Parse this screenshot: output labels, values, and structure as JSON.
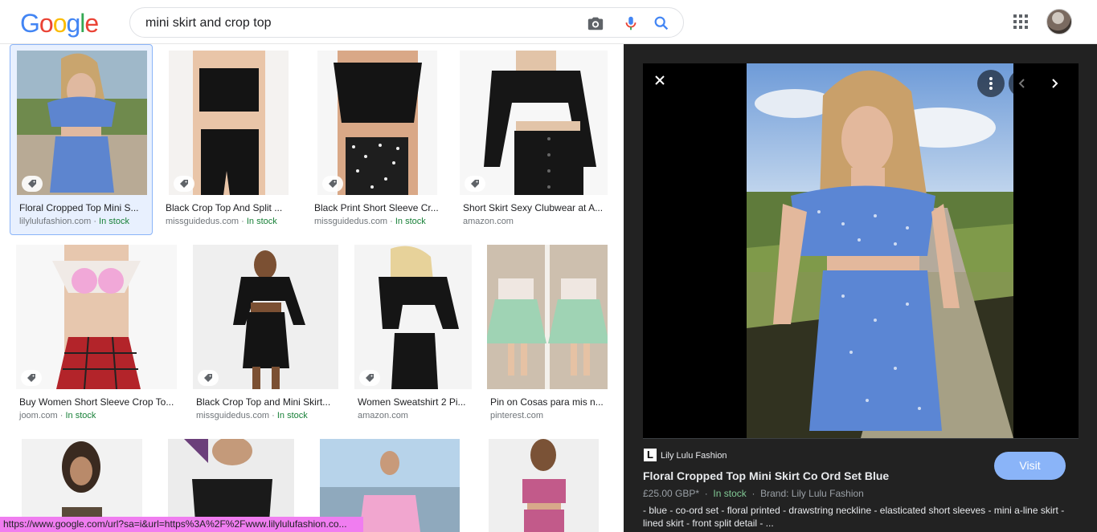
{
  "search": {
    "query": "mini skirt and crop top"
  },
  "results": [
    {
      "title": "Floral Cropped Top Mini S...",
      "source": "lilylulufashion.com",
      "stock": "In stock"
    },
    {
      "title": "Black Crop Top And Split ...",
      "source": "missguidedus.com",
      "stock": "In stock"
    },
    {
      "title": "Black Print Short Sleeve Cr...",
      "source": "missguidedus.com",
      "stock": "In stock"
    },
    {
      "title": "Short Skirt Sexy Clubwear at A...",
      "source": "amazon.com",
      "stock": ""
    },
    {
      "title": "Buy Women Short Sleeve Crop To...",
      "source": "joom.com",
      "stock": "In stock"
    },
    {
      "title": "Black Crop Top and Mini Skirt...",
      "source": "missguidedus.com",
      "stock": "In stock"
    },
    {
      "title": "Women Sweatshirt 2 Pi...",
      "source": "amazon.com",
      "stock": ""
    },
    {
      "title": "Pin on Cosas para mis n...",
      "source": "pinterest.com",
      "stock": ""
    }
  ],
  "status_url": "https://www.google.com/url?sa=i&url=https%3A%2F%2Fwww.lilylulufashion.co...",
  "panel": {
    "source_name": "Lily Lulu Fashion",
    "source_logo": "L",
    "title": "Floral Cropped Top Mini Skirt Co Ord Set Blue",
    "price": "£25.00 GBP*",
    "stock": "In stock",
    "brand": "Brand: Lily Lulu Fashion",
    "separator": "·",
    "description": "- blue - co-ord set - floral printed - drawstring neckline - elasticated short sleeves - mini a-line skirt - lined skirt - front split detail - ...",
    "visit_label": "Visit"
  },
  "colors": {
    "accent": "#8ab4f8",
    "stock_green": "#188038",
    "panel_bg": "#222222"
  }
}
